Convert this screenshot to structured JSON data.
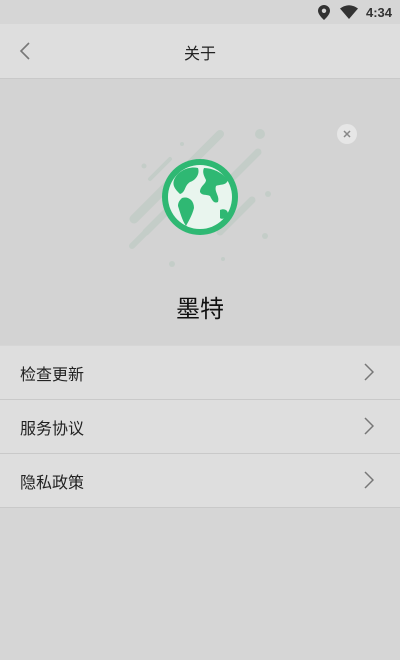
{
  "status_bar": {
    "time": "4:34",
    "icons": [
      "location-icon",
      "wifi-icon"
    ]
  },
  "nav": {
    "title": "关于",
    "back_icon": "chevron-left-icon"
  },
  "hero": {
    "app_name": "墨特",
    "close_icon": "close-icon",
    "logo_icon": "globe-icon",
    "accent_color": "#2fb873"
  },
  "menu": {
    "items": [
      {
        "label": "检查更新",
        "icon": "chevron-right-icon"
      },
      {
        "label": "服务协议",
        "icon": "chevron-right-icon"
      },
      {
        "label": "隐私政策",
        "icon": "chevron-right-icon"
      }
    ]
  }
}
